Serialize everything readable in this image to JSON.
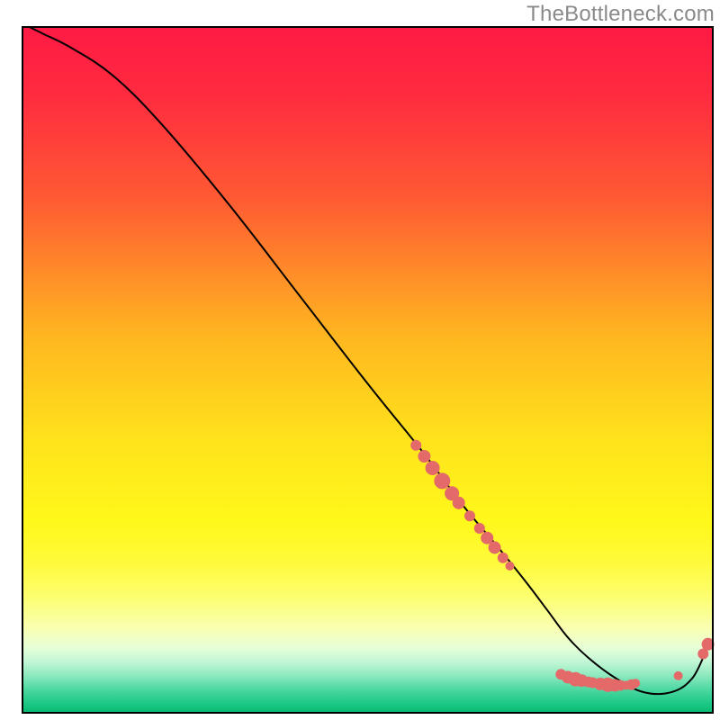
{
  "watermark": "TheBottleneck.com",
  "chart_data": {
    "type": "line",
    "title": "",
    "xlabel": "",
    "ylabel": "",
    "xlim": [
      0,
      100
    ],
    "ylim": [
      0,
      100
    ],
    "background_gradient": {
      "stops": [
        {
          "offset": 0.0,
          "color": "#ff1a44"
        },
        {
          "offset": 0.1,
          "color": "#ff2b3f"
        },
        {
          "offset": 0.25,
          "color": "#ff5a33"
        },
        {
          "offset": 0.45,
          "color": "#ffb620"
        },
        {
          "offset": 0.6,
          "color": "#ffe21c"
        },
        {
          "offset": 0.72,
          "color": "#fff81a"
        },
        {
          "offset": 0.78,
          "color": "#fffa3a"
        },
        {
          "offset": 0.83,
          "color": "#fdff6e"
        },
        {
          "offset": 0.88,
          "color": "#f8ffb7"
        },
        {
          "offset": 0.905,
          "color": "#e6ffd6"
        },
        {
          "offset": 0.925,
          "color": "#c3f7d6"
        },
        {
          "offset": 0.945,
          "color": "#8ee9bf"
        },
        {
          "offset": 0.965,
          "color": "#4fd8a2"
        },
        {
          "offset": 0.985,
          "color": "#1fc987"
        },
        {
          "offset": 1.0,
          "color": "#07ba71"
        }
      ]
    },
    "series": [
      {
        "name": "curve",
        "color": "#000000",
        "x": [
          1,
          3,
          7,
          13,
          20,
          30,
          40,
          50,
          58,
          64,
          69,
          73,
          76,
          79,
          82,
          86,
          90,
          94,
          97,
          99
        ],
        "y": [
          100,
          99,
          97,
          93,
          86,
          74,
          61,
          48,
          38,
          30,
          24,
          19,
          15,
          11,
          8,
          5,
          3,
          3,
          5,
          9
        ]
      }
    ],
    "markers": [
      {
        "name": "cluster-upper",
        "color": "#e46a6a",
        "radius_range": [
          5,
          9
        ],
        "points": [
          {
            "x": 57.0,
            "y": 39.0,
            "r": 6
          },
          {
            "x": 58.2,
            "y": 37.4,
            "r": 7
          },
          {
            "x": 59.4,
            "y": 35.7,
            "r": 8
          },
          {
            "x": 60.8,
            "y": 33.8,
            "r": 9
          },
          {
            "x": 62.2,
            "y": 32.0,
            "r": 8
          },
          {
            "x": 63.2,
            "y": 30.6,
            "r": 7
          },
          {
            "x": 64.8,
            "y": 28.7,
            "r": 6
          },
          {
            "x": 66.2,
            "y": 26.9,
            "r": 6
          },
          {
            "x": 67.3,
            "y": 25.5,
            "r": 7
          },
          {
            "x": 68.4,
            "y": 24.1,
            "r": 7
          },
          {
            "x": 69.6,
            "y": 22.6,
            "r": 6
          },
          {
            "x": 70.6,
            "y": 21.4,
            "r": 5
          }
        ]
      },
      {
        "name": "cluster-bottom",
        "color": "#e46a6a",
        "radius_range": [
          5,
          8
        ],
        "points": [
          {
            "x": 78.0,
            "y": 5.6,
            "r": 6
          },
          {
            "x": 79.0,
            "y": 5.2,
            "r": 7
          },
          {
            "x": 80.1,
            "y": 4.9,
            "r": 8
          },
          {
            "x": 81.0,
            "y": 4.7,
            "r": 7
          },
          {
            "x": 82.0,
            "y": 4.5,
            "r": 6
          },
          {
            "x": 82.6,
            "y": 4.4,
            "r": 6
          },
          {
            "x": 83.7,
            "y": 4.2,
            "r": 7
          },
          {
            "x": 84.8,
            "y": 4.1,
            "r": 8
          },
          {
            "x": 85.8,
            "y": 4.0,
            "r": 7
          },
          {
            "x": 86.6,
            "y": 4.0,
            "r": 6
          },
          {
            "x": 87.4,
            "y": 4.0,
            "r": 5
          },
          {
            "x": 88.2,
            "y": 4.1,
            "r": 6
          },
          {
            "x": 88.8,
            "y": 4.3,
            "r": 5
          },
          {
            "x": 95.0,
            "y": 5.4,
            "r": 5
          },
          {
            "x": 98.6,
            "y": 8.6,
            "r": 6
          },
          {
            "x": 99.3,
            "y": 10.0,
            "r": 7
          }
        ]
      }
    ]
  }
}
